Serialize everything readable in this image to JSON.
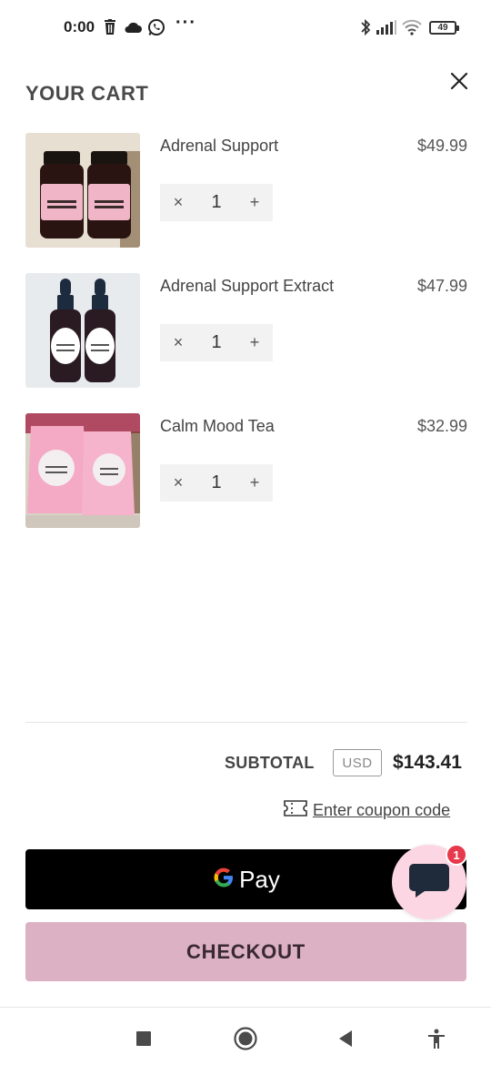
{
  "status_bar": {
    "time": "0:00",
    "icons": [
      "trash-icon",
      "cloud-icon",
      "whatsapp-icon",
      "more-dots-icon",
      "bluetooth-icon",
      "signal-icon",
      "wifi-icon"
    ],
    "dots": "···",
    "battery": "49"
  },
  "header": {
    "title": "YOUR CART",
    "close_icon": "close-icon"
  },
  "items": [
    {
      "name": "Adrenal Support",
      "price": "$49.99",
      "quantity": "1",
      "remove": "×",
      "add": "+",
      "image": "adrenal-support-bottles",
      "bg": "#e8e2d6",
      "accent": "#f0b6c8"
    },
    {
      "name": "Adrenal Support Extract",
      "price": "$47.99",
      "quantity": "1",
      "remove": "×",
      "add": "+",
      "image": "adrenal-support-extract-dropper-bottles",
      "bg": "#e9ecee",
      "accent": "#ffffff"
    },
    {
      "name": "Calm Mood Tea",
      "price": "$32.99",
      "quantity": "1",
      "remove": "×",
      "add": "+",
      "image": "calm-mood-tea-pouches",
      "bg": "#ddd6cc",
      "accent": "#f4a9c4"
    }
  ],
  "summary": {
    "subtotal_label": "SUBTOTAL",
    "currency": "USD",
    "subtotal_value": "$143.41",
    "coupon_text": "Enter coupon code",
    "coupon_icon": "ticket-icon"
  },
  "gpay": {
    "label": "Pay",
    "brand": "#000000"
  },
  "checkout": {
    "label": "CHECKOUT",
    "color": "#dbb1c3"
  },
  "chat": {
    "badge": "1",
    "icon": "chat-bubble-icon",
    "bg": "#fcd7e3",
    "badge_color": "#e63a4c"
  },
  "nav": {
    "icons": [
      "recents-square-icon",
      "home-circle-icon",
      "back-triangle-icon",
      "accessibility-icon"
    ]
  }
}
